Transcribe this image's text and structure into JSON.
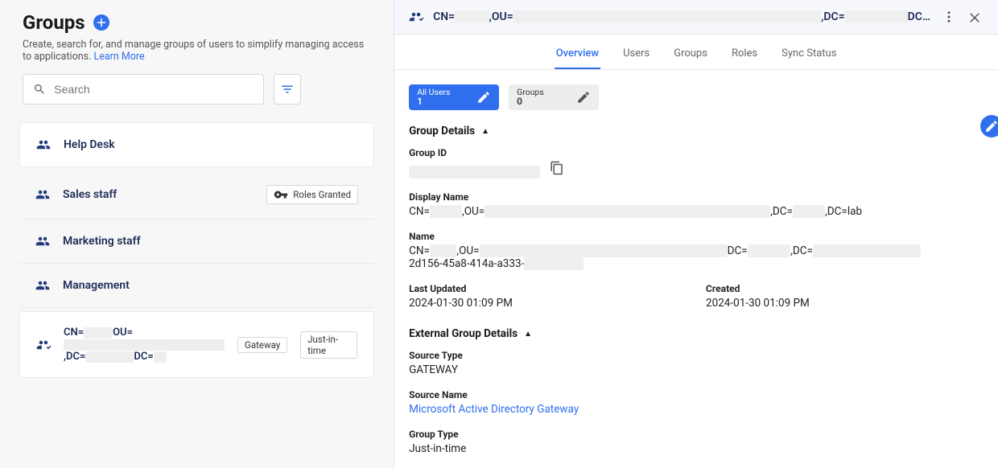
{
  "header": {
    "title": "Groups",
    "subtitle": "Create, search for, and manage groups of users to simplify managing access to applications.",
    "learn_more": "Learn More",
    "search_placeholder": "Search"
  },
  "groups_list": [
    {
      "name": "Help Desk",
      "roles_granted": false,
      "external_dn": null
    },
    {
      "name": "Sales staff",
      "roles_granted": true,
      "external_dn": null
    },
    {
      "name": "Marketing staff",
      "roles_granted": false,
      "external_dn": null
    },
    {
      "name": "Management",
      "roles_granted": false,
      "external_dn": null
    },
    {
      "name": null,
      "roles_granted": false,
      "external_dn": {
        "cn": "",
        "ou": "",
        "dc1": "",
        "dc2": ""
      },
      "tags": [
        "Gateway",
        "Just-in-time"
      ]
    }
  ],
  "roles_granted_label": "Roles Granted",
  "right": {
    "header_dn": {
      "cn": "",
      "ou": "",
      "dc1": "",
      "dc_tail": "DC…"
    },
    "tabs": [
      "Overview",
      "Users",
      "Groups",
      "Roles",
      "Sync Status"
    ],
    "active_tab": 0,
    "stats": {
      "all_users_label": "All Users",
      "all_users_value": "1",
      "groups_label": "Groups",
      "groups_value": "0"
    },
    "group_details_title": "Group Details",
    "group_id_label": "Group ID",
    "group_id_value": " ",
    "display_name_label": "Display Name",
    "display_name": {
      "cn": "",
      "ou": "",
      "dc1": "",
      "dc2": "lab"
    },
    "name_label": "Name",
    "name": {
      "cn": "",
      "ou": "",
      "dc1": "",
      "dc2": "",
      "guid": "2d156-45a8-414a-a333-"
    },
    "last_updated_label": "Last Updated",
    "last_updated_value": "2024-01-30 01:09 PM",
    "created_label": "Created",
    "created_value": "2024-01-30 01:09 PM",
    "external_title": "External Group Details",
    "source_type_label": "Source Type",
    "source_type_value": "GATEWAY",
    "source_name_label": "Source Name",
    "source_name_value": "Microsoft Active Directory Gateway",
    "group_type_label": "Group Type",
    "group_type_value": "Just-in-time"
  }
}
